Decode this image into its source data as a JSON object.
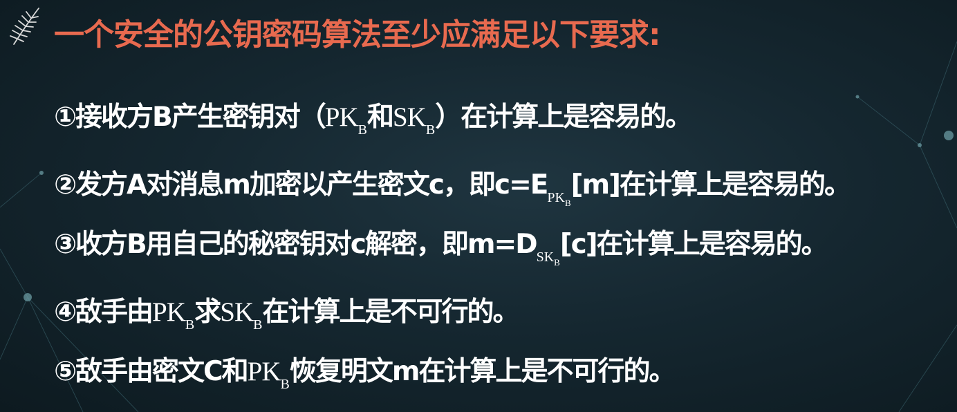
{
  "slide": {
    "title": "一个安全的公钥密码算法至少应满足以下要求:",
    "accent_color": "#e86a4f",
    "text_color": "#ffffff",
    "logo_icon": "leaf-icon"
  },
  "requirements": [
    {
      "marker": "①",
      "parts": [
        "接收方B产生密钥对（",
        "PK",
        "B",
        "和",
        "SK",
        "B",
        "）在计算上是容易的。"
      ]
    },
    {
      "marker": "②",
      "parts": [
        "发方A对消息m加密以产生密文c，即c=E",
        "PK",
        "B",
        "[m]在计算上是容易的。"
      ]
    },
    {
      "marker": "③",
      "parts": [
        "收方B用自己的秘密钥对c解密，即m=D",
        "SK",
        "B",
        "[c]在计算上是容易的。"
      ]
    },
    {
      "marker": "④",
      "parts": [
        "敌手由",
        "PK",
        "B",
        "求",
        "SK",
        "B",
        "在计算上是不可行的。"
      ]
    },
    {
      "marker": "⑤",
      "parts": [
        "敌手由密文C和",
        "PK",
        "B",
        "恢复明文m在计算上是不可行的。"
      ]
    }
  ]
}
